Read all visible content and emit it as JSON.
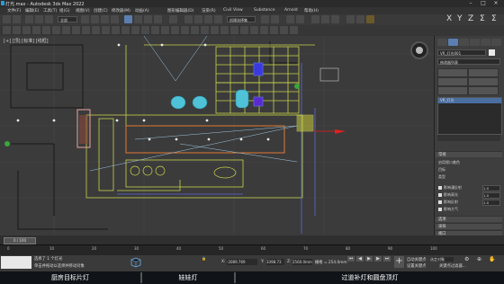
{
  "window": {
    "title": "灯光.max - Autodesk 3ds Max 2022"
  },
  "menu": [
    "文件(F)",
    "编辑(E)",
    "工具(T)",
    "组(G)",
    "视图(V)",
    "创建(C)",
    "修改器(M)",
    "动画(A)",
    "图形编辑器(D)",
    "渲染(R)",
    "Civil View",
    "Substance",
    "Arnold",
    "帮助(H)"
  ],
  "toolbar": {
    "selection_set": "创建选择集",
    "layer_label": "全部"
  },
  "viewport": {
    "label": "[+] [顶] [标准] [线框]"
  },
  "panel": {
    "object_name": "VR_灯光001",
    "modifier_list": "修改器列表",
    "stack_item": "VR_灯光",
    "section_general": "常规",
    "on_label": "启用视口着色",
    "targeted_label": "目标",
    "type_label": "类型",
    "rollouts": [
      "选项",
      "采样",
      "视口"
    ],
    "checks": [
      "影响漫反射",
      "影响高光",
      "影响反射",
      "影响大气"
    ],
    "spin_values": [
      "1.0",
      "1.0",
      "1.0"
    ]
  },
  "timeline": {
    "frame": "0 / 100",
    "ticks": [
      "0",
      "10",
      "20",
      "30",
      "40",
      "50",
      "60",
      "70",
      "80",
      "90",
      "100"
    ]
  },
  "status": {
    "selected": "选择了 1 个灯光",
    "hint": "单击并拖动以选择并移动对象",
    "x_label": "X:",
    "x_value": "-2089.769",
    "y_label": "Y:",
    "y_value": "3398.73",
    "z_label": "Z:",
    "z_value": "2560.0mm",
    "grid": "栅格 = 254.0mm",
    "addtime": "添加时间标记",
    "autokey": "自动关键点",
    "setkey": "设置关键点",
    "filter": "关键点过滤器...",
    "selected_dropdown": "选定对象"
  },
  "captions": [
    "厨房目标片灯",
    "娃娃灯",
    "过道补灯和圆盘顶灯"
  ],
  "colors": {
    "accent": "#4a90d9",
    "viewport_bg": "#3b3b3b",
    "selected": "#f0a500"
  }
}
